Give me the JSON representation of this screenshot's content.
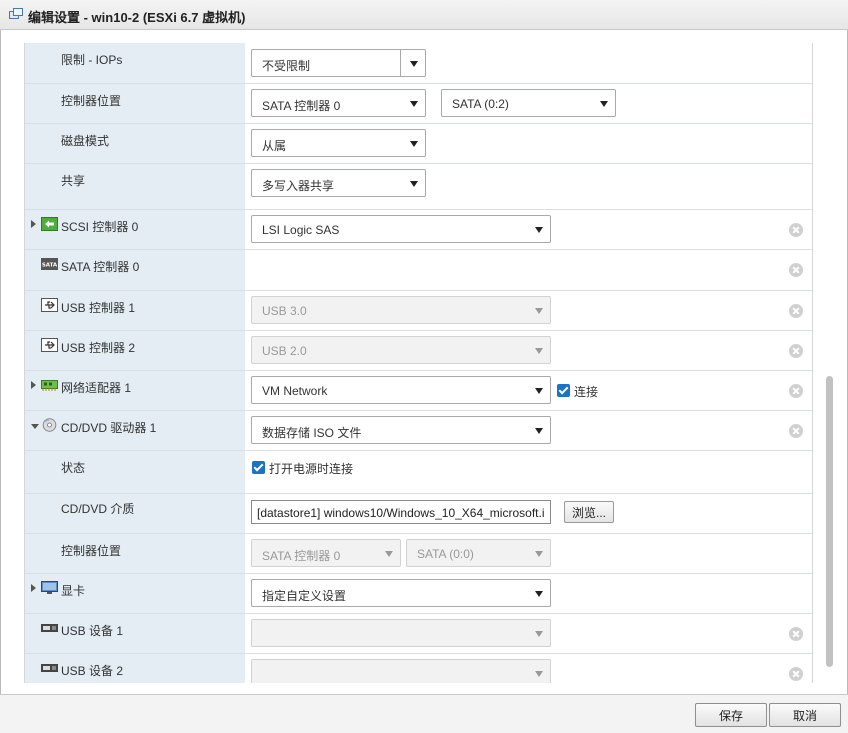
{
  "window": {
    "title": "编辑设置 - win10-2 (ESXi 6.7 虚拟机)",
    "icon": "vm-settings-icon"
  },
  "rows": {
    "iops": {
      "label": "限制 - IOPs",
      "value": "不受限制"
    },
    "controller_location": {
      "label": "控制器位置",
      "controller": "SATA 控制器 0",
      "port": "SATA (0:2)"
    },
    "disk_mode": {
      "label": "磁盘模式",
      "value": "从属"
    },
    "sharing": {
      "label": "共享",
      "value": "多写入器共享"
    },
    "scsi": {
      "label": "SCSI 控制器 0",
      "value": "LSI Logic SAS",
      "icon": "scsi-controller-icon"
    },
    "sata": {
      "label": "SATA 控制器 0",
      "icon": "sata-icon"
    },
    "usb1": {
      "label": "USB 控制器 1",
      "value": "USB 3.0",
      "icon": "usb-icon"
    },
    "usb2": {
      "label": "USB 控制器 2",
      "value": "USB 2.0",
      "icon": "usb-icon"
    },
    "nic": {
      "label": "网络适配器 1",
      "value": "VM Network",
      "connect_label": "连接",
      "connect_checked": true,
      "icon": "network-adapter-icon"
    },
    "cdvd": {
      "label": "CD/DVD 驱动器 1",
      "value": "数据存储 ISO 文件",
      "icon": "cd-dvd-icon"
    },
    "status": {
      "label": "状态",
      "checkbox_label": "打开电源时连接",
      "checked": true
    },
    "media": {
      "label": "CD/DVD 介质",
      "value": "[datastore1] windows10/Windows_10_X64_microsoft.i",
      "browse_label": "浏览..."
    },
    "cd_controller_location": {
      "label": "控制器位置",
      "controller": "SATA 控制器 0",
      "port": "SATA (0:0)"
    },
    "video": {
      "label": "显卡",
      "value": "指定自定义设置",
      "icon": "monitor-icon"
    },
    "usb_dev1": {
      "label": "USB 设备 1",
      "value": "",
      "icon": "usb-device-icon"
    },
    "usb_dev2": {
      "label": "USB 设备 2",
      "value": "",
      "icon": "usb-device-icon"
    }
  },
  "footer": {
    "save_label": "保存",
    "cancel_label": "取消"
  },
  "colors": {
    "label_column": "#e3edf3",
    "checkbox": "#1a73c8"
  }
}
